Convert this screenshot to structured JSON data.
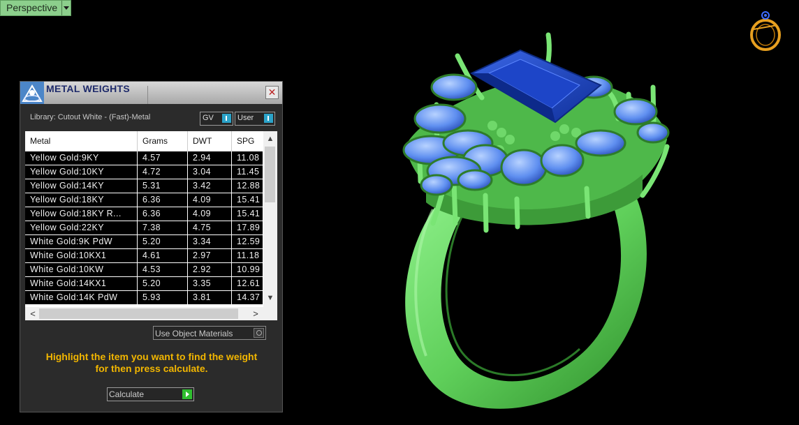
{
  "viewport": {
    "label": "Perspective"
  },
  "panel": {
    "title": "METAL WEIGHTS",
    "close_glyph": "✕",
    "library": "Library: Cutout White - (Fast)-Metal",
    "toggle_gv": "GV",
    "toggle_user": "User",
    "columns": [
      "Metal",
      "Grams",
      "DWT",
      "SPG"
    ],
    "rows": [
      [
        "Yellow Gold:9KY",
        "4.57",
        "2.94",
        "11.08"
      ],
      [
        "Yellow Gold:10KY",
        "4.72",
        "3.04",
        "11.45"
      ],
      [
        "Yellow Gold:14KY",
        "5.31",
        "3.42",
        "12.88"
      ],
      [
        "Yellow Gold:18KY",
        "6.36",
        "4.09",
        "15.41"
      ],
      [
        "Yellow Gold:18KY R...",
        "6.36",
        "4.09",
        "15.41"
      ],
      [
        "Yellow Gold:22KY",
        "7.38",
        "4.75",
        "17.89"
      ],
      [
        "White Gold:9K PdW",
        "5.20",
        "3.34",
        "12.59"
      ],
      [
        "White Gold:10KX1",
        "4.61",
        "2.97",
        "11.18"
      ],
      [
        "White Gold:10KW",
        "4.53",
        "2.92",
        "10.99"
      ],
      [
        "White Gold:14KX1",
        "5.20",
        "3.35",
        "12.61"
      ],
      [
        "White Gold:14K PdW",
        "5.93",
        "3.81",
        "14.37"
      ]
    ],
    "use_object_materials": "Use Object Materials",
    "hint_line1": "Highlight the item you want to find the weight",
    "hint_line2": "for then press calculate.",
    "calculate_label": "Calculate"
  },
  "colors": {
    "ring_metal": "#6fd86a",
    "gem_blue": "#2c52c8",
    "hint_text": "#f2b600",
    "viewport_label_bg": "#8ccf8c"
  },
  "icons": {
    "corner": "ring-icon",
    "panel_logo": "metal-weights-icon",
    "scroll_up": "▲",
    "scroll_down": "▼",
    "scroll_left": "<",
    "scroll_right": ">"
  }
}
